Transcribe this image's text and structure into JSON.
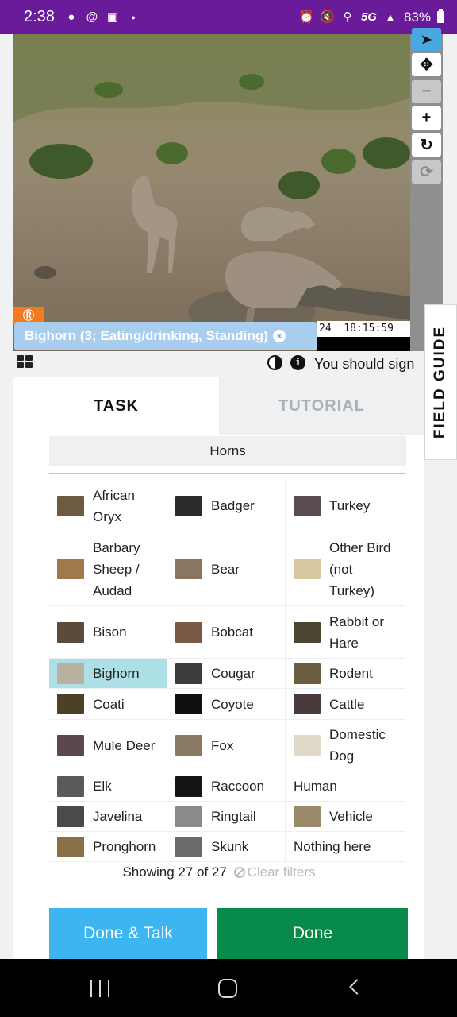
{
  "status_bar": {
    "time": "2:38",
    "left_icons": [
      "snapchat-icon",
      "threads-icon",
      "app-icon",
      "dot-icon"
    ],
    "network": "5G",
    "battery": "83%"
  },
  "subject": {
    "camera_timestamp": "24  18:15:59",
    "camera_logo": "Ⓡ",
    "annotation": "Bighorn (3; Eating/drinking, Standing)",
    "annotation_close": "×"
  },
  "toolbar": {
    "tools": [
      {
        "name": "select-tool-icon",
        "glyph": "▲"
      },
      {
        "name": "move-tool-icon",
        "glyph": "✥"
      },
      {
        "name": "zoom-out-icon",
        "glyph": "−"
      },
      {
        "name": "zoom-in-icon",
        "glyph": "+"
      },
      {
        "name": "rotate-icon",
        "glyph": "↻"
      },
      {
        "name": "reset-icon",
        "glyph": "⟳"
      }
    ]
  },
  "meta_row": {
    "sign_message": "You should sign",
    "info_glyph": "i"
  },
  "field_guide": {
    "label": "FIELD GUIDE"
  },
  "tabs": {
    "task": "TASK",
    "tutorial": "TUTORIAL"
  },
  "filter": {
    "label": "Horns"
  },
  "choices": [
    [
      {
        "label": "African Oryx",
        "thumb": "#6d5a40"
      },
      {
        "label": "Badger",
        "thumb": "#2c2c2c"
      },
      {
        "label": "Turkey",
        "thumb": "#5a4c52"
      }
    ],
    [
      {
        "label": "Barbary Sheep / Audad",
        "thumb": "#a0794a"
      },
      {
        "label": "Bear",
        "thumb": "#8a7660"
      },
      {
        "label": "Other Bird (not Turkey)",
        "thumb": "#d8c8a0"
      }
    ],
    [
      {
        "label": "Bison",
        "thumb": "#5c4a3a"
      },
      {
        "label": "Bobcat",
        "thumb": "#7a5a44"
      },
      {
        "label": "Rabbit or Hare",
        "thumb": "#4a4430"
      }
    ],
    [
      {
        "label": "Bighorn",
        "thumb": "#b8b0a0"
      },
      {
        "label": "Cougar",
        "thumb": "#3c3c3c"
      },
      {
        "label": "Rodent",
        "thumb": "#6c5c40"
      }
    ],
    [
      {
        "label": "Coati",
        "thumb": "#4c4026"
      },
      {
        "label": "Coyote",
        "thumb": "#101010"
      },
      {
        "label": "Cattle",
        "thumb": "#4a3a3c"
      }
    ],
    [
      {
        "label": "Mule Deer",
        "thumb": "#5c4650"
      },
      {
        "label": "Fox",
        "thumb": "#8a7a64"
      },
      {
        "label": "Domestic Dog",
        "thumb": "#e0d8c8"
      }
    ],
    [
      {
        "label": "Elk",
        "thumb": "#5a5a5a"
      },
      {
        "label": "Raccoon",
        "thumb": "#141414"
      },
      {
        "label": "Human",
        "thumb": ""
      }
    ],
    [
      {
        "label": "Javelina",
        "thumb": "#4a4a4a"
      },
      {
        "label": "Ringtail",
        "thumb": "#8a8a8a"
      },
      {
        "label": "Vehicle",
        "thumb": "#9a8a6a"
      }
    ],
    [
      {
        "label": "Pronghorn",
        "thumb": "#8a7048"
      },
      {
        "label": "Skunk",
        "thumb": "#6a6a6a"
      },
      {
        "label": "Nothing here",
        "thumb": ""
      }
    ]
  ],
  "summary": {
    "showing": "Showing 27 of 27",
    "clear": "Clear filters"
  },
  "buttons": {
    "done_talk": "Done & Talk",
    "done": "Done"
  }
}
